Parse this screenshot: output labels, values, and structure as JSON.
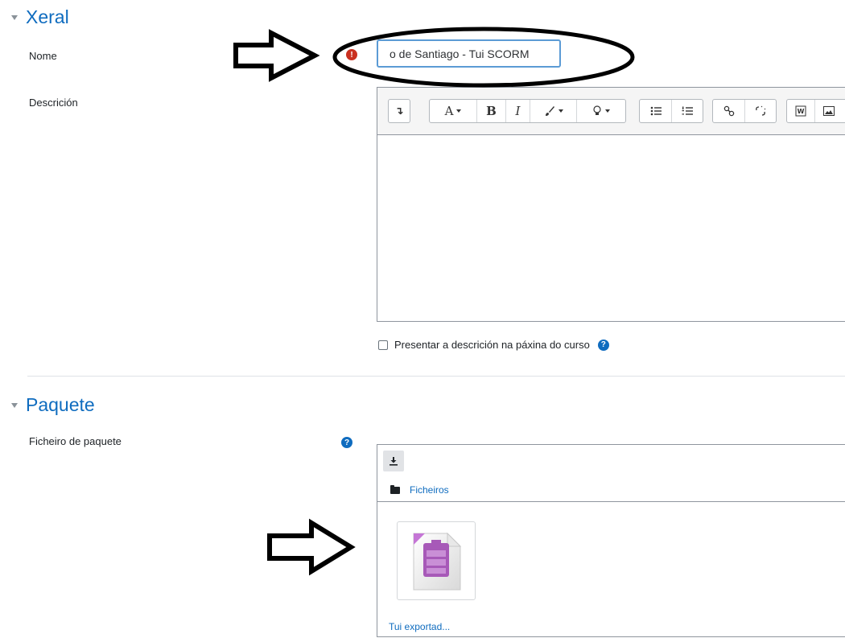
{
  "sections": {
    "general": {
      "title": "Xeral"
    },
    "package": {
      "title": "Paquete"
    }
  },
  "form": {
    "name": {
      "label": "Nome",
      "value": "o de Santiago - Tui SCORM",
      "required_icon": "exclamation-icon"
    },
    "description": {
      "label": "Descrición",
      "toolbar_icons": [
        "toolbar-toggle-icon",
        "font-style-icon",
        "bold-icon",
        "italic-icon",
        "text-color-icon",
        "inline-style-icon",
        "unordered-list-icon",
        "ordered-list-icon",
        "link-icon",
        "unlink-icon",
        "word-import-icon",
        "image-icon"
      ]
    },
    "show_description": {
      "label": "Presentar a descrición na páxina do curso",
      "checked": false,
      "help_icon": "question-circle-icon"
    },
    "package_file": {
      "label": "Ficheiro de paquete",
      "help_icon": "question-circle-icon",
      "folder_label": "Ficheiros",
      "file_name": "Tui exportad..."
    }
  },
  "colors": {
    "accent": "#0f6cbf",
    "required": "#ca3120",
    "scorm_icon": "#a759b8"
  }
}
